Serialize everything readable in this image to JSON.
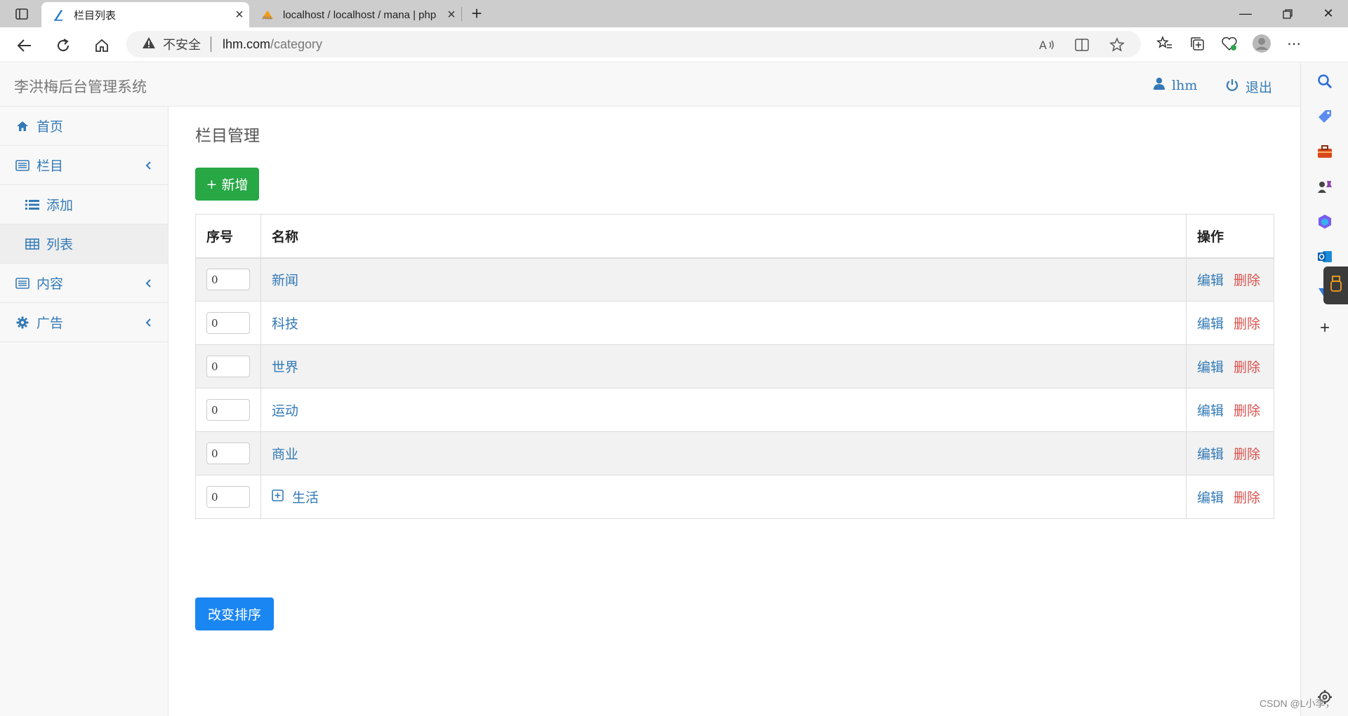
{
  "browser": {
    "tabs": [
      {
        "title": "栏目列表",
        "active": true
      },
      {
        "title": "localhost / localhost / mana | php",
        "active": false
      }
    ],
    "address": {
      "security_label": "不安全",
      "host": "lhm.com",
      "path": "/category"
    }
  },
  "header": {
    "brand": "李洪梅后台管理系统",
    "user": "lhm",
    "logout": "退出"
  },
  "sidebar": {
    "items": [
      {
        "label": "首页"
      },
      {
        "label": "栏目"
      },
      {
        "label": "添加"
      },
      {
        "label": "列表"
      },
      {
        "label": "内容"
      },
      {
        "label": "广告"
      }
    ]
  },
  "main": {
    "title": "栏目管理",
    "add_button": "新增",
    "sort_button": "改变排序",
    "table": {
      "headers": {
        "seq": "序号",
        "name": "名称",
        "ops": "操作"
      },
      "edit_label": "编辑",
      "delete_label": "删除",
      "rows": [
        {
          "seq": "0",
          "name": "新闻"
        },
        {
          "seq": "0",
          "name": "科技"
        },
        {
          "seq": "0",
          "name": "世界"
        },
        {
          "seq": "0",
          "name": "运动"
        },
        {
          "seq": "0",
          "name": "商业"
        },
        {
          "seq": "0",
          "name": "生活"
        }
      ]
    }
  },
  "watermark": "CSDN @L小李，",
  "colors": {
    "link": "#337ab7",
    "danger": "#d9534f",
    "success": "#28a745",
    "primary": "#1a86f2"
  }
}
